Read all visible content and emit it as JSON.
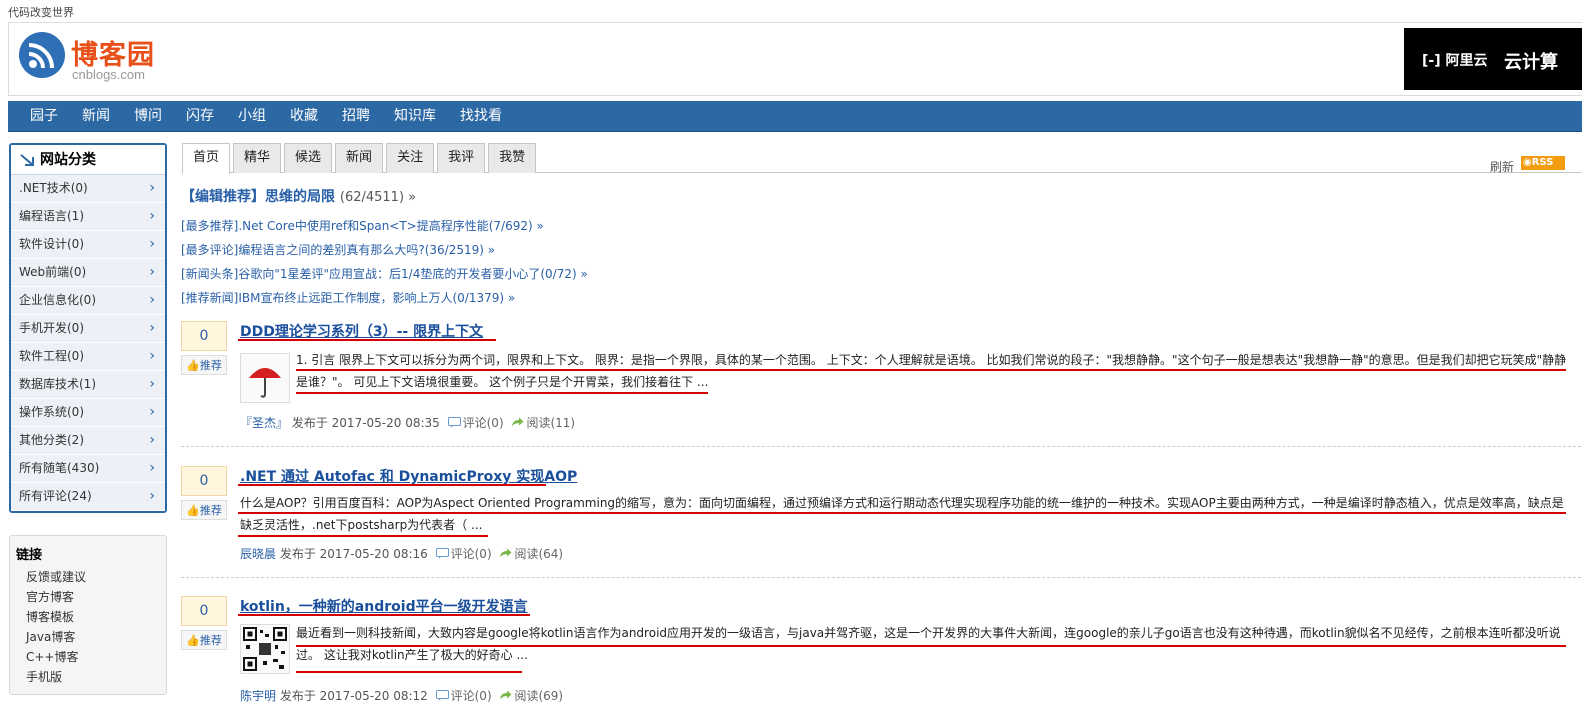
{
  "slogan": "代码改变世界",
  "logo": {
    "name": "博客园",
    "domain": "cnblogs.com"
  },
  "ad": {
    "brand": "阿里云",
    "text": "云计算"
  },
  "nav": [
    "园子",
    "新闻",
    "博问",
    "闪存",
    "小组",
    "收藏",
    "招聘",
    "知识库",
    "找找看"
  ],
  "sidebar": {
    "title": "网站分类",
    "items": [
      {
        "label": ".NET技术(0)"
      },
      {
        "label": "编程语言(1)"
      },
      {
        "label": "软件设计(0)"
      },
      {
        "label": "Web前端(0)"
      },
      {
        "label": "企业信息化(0)"
      },
      {
        "label": "手机开发(0)"
      },
      {
        "label": "软件工程(0)"
      },
      {
        "label": "数据库技术(1)"
      },
      {
        "label": "操作系统(0)"
      },
      {
        "label": "其他分类(2)"
      },
      {
        "label": "所有随笔(430)"
      },
      {
        "label": "所有评论(24)"
      }
    ]
  },
  "links": {
    "title": "链接",
    "items": [
      "反馈或建议",
      "官方博客",
      "博客模板",
      "Java博客",
      "C++博客",
      "手机版"
    ]
  },
  "tabs": [
    "首页",
    "精华",
    "候选",
    "新闻",
    "关注",
    "我评",
    "我赞"
  ],
  "toolbar": {
    "refresh": "刷新",
    "rss": "RSS"
  },
  "headline": {
    "label": "【编辑推荐】思维的局限",
    "count": "(62/4511) »"
  },
  "recommendations": [
    "[最多推荐].Net Core中使用ref和Span<T>提高程序性能(7/692) »",
    "[最多评论]编程语言之间的差别真有那么大吗?(36/2519) »",
    "[新闻头条]谷歌向\"1星差评\"应用宣战：后1/4垫底的开发者要小心了(0/72) »",
    "[推荐新闻]IBM宣布终止远距工作制度，影响上万人(0/1379) »"
  ],
  "posts": [
    {
      "digg": "0",
      "digg_label": "推荐",
      "title": "DDD理论学习系列（3）-- 限界上下文",
      "summary": "1. 引言 限界上下文可以拆分为两个词，限界和上下文。 限界：是指一个界限，具体的某一个范围。 上下文：个人理解就是语境。 比如我们常说的段子：\"我想静静。\"这个句子一般是想表达\"我想静一静\"的意思。但是我们却把它玩笑成\"静静是谁？\"。 可见上下文语境很重要。 这个例子只是个开胃菜，我们接着往下 ...",
      "author": "『圣杰』",
      "time": "发布于 2017-05-20 08:35",
      "comments": "评论(0)",
      "reads": "阅读(11)"
    },
    {
      "digg": "0",
      "digg_label": "推荐",
      "title": ".NET 通过 Autofac 和 DynamicProxy 实现AOP",
      "summary": "什么是AOP？引用百度百科：AOP为Aspect Oriented Programming的缩写，意为：面向切面编程，通过预编译方式和运行期动态代理实现程序功能的统一维护的一种技术。实现AOP主要由两种方式，一种是编译时静态植入，优点是效率高，缺点是缺乏灵活性，.net下postsharp为代表者（ ...",
      "author": "辰晓晨",
      "time": "发布于 2017-05-20 08:16",
      "comments": "评论(0)",
      "reads": "阅读(64)"
    },
    {
      "digg": "0",
      "digg_label": "推荐",
      "title": "kotlin，一种新的android平台一级开发语言",
      "summary": "最近看到一则科技新闻，大致内容是google将kotlin语言作为android应用开发的一级语言，与java并驾齐驱，这是一个开发界的大事件大新闻，连google的亲儿子go语言也没有这种待遇，而kotlin貌似名不见经传，之前根本连听都没听说过。 这让我对kotlin产生了极大的好奇心 ...",
      "author": "陈宇明",
      "time": "发布于 2017-05-20 08:12",
      "comments": "评论(0)",
      "reads": "阅读(69)"
    }
  ]
}
